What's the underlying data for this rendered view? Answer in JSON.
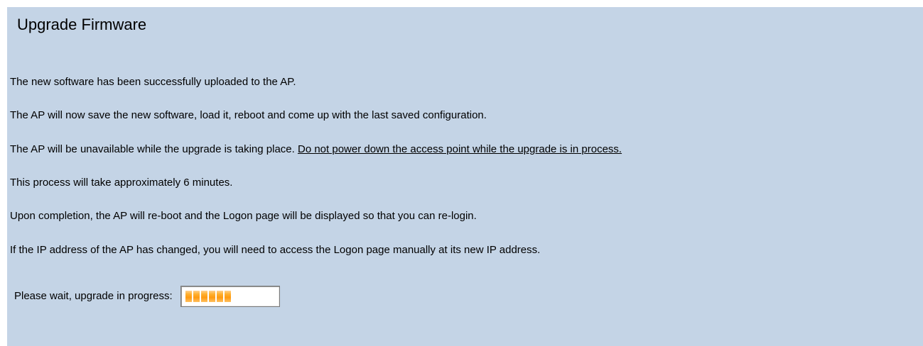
{
  "header": {
    "title": "Upgrade Firmware"
  },
  "messages": {
    "line1": "The new software has been successfully uploaded to the AP.",
    "line2": "The AP will now save the new software, load it, reboot and come up with the last saved configuration.",
    "line3_prefix": "The AP will be unavailable while the upgrade is taking place. ",
    "line3_warning": "Do not power down the access point while the upgrade is in process.",
    "line4": "This process will take approximately 6 minutes.",
    "line5": "Upon completion, the AP will re-boot and the Logon page will be displayed so that you can re-login.",
    "line6": "If the IP address of the AP has changed, you will need to access the Logon page manually at its new IP address."
  },
  "progress": {
    "label": "Please wait, upgrade in progress:",
    "segments_filled": 6,
    "segments_total": 13,
    "fill_color": "#ff9a10"
  },
  "colors": {
    "background": "#c4d4e6"
  }
}
